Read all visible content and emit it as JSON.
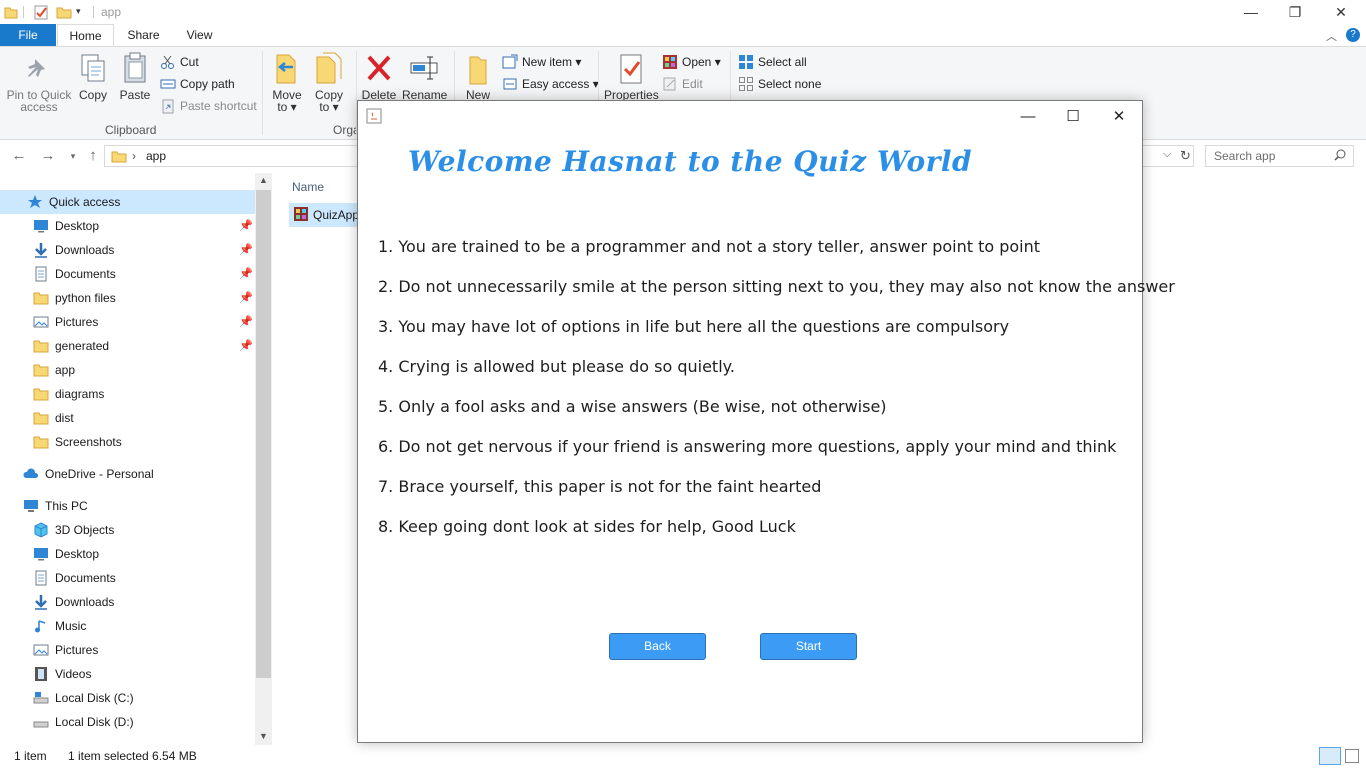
{
  "window": {
    "title": "app"
  },
  "tabs": [
    {
      "label": "File"
    },
    {
      "label": "Home"
    },
    {
      "label": "Share"
    },
    {
      "label": "View"
    }
  ],
  "ribbon": {
    "pin_label_1": "Pin to Quick",
    "pin_label_2": "access",
    "copy": "Copy",
    "paste": "Paste",
    "cut": "Cut",
    "copy_path": "Copy path",
    "paste_shortcut": "Paste shortcut",
    "clipboard_group": "Clipboard",
    "move_to_1": "Move",
    "move_to_2": "to ▾",
    "copy_to_1": "Copy",
    "copy_to_2": "to ▾",
    "organise_group": "Orga",
    "delete": "Delete",
    "rename": "Rename",
    "new_folder": "New",
    "new_item": "New item ▾",
    "easy_access": "Easy access ▾",
    "properties": "Properties",
    "open": "Open ▾",
    "edit": "Edit",
    "select_all": "Select all",
    "select_none": "Select none"
  },
  "address": {
    "path": "app",
    "search_placeholder": "Search app"
  },
  "nav": {
    "quick_access": "Quick access",
    "pinned": [
      {
        "label": "Desktop",
        "pinned": true
      },
      {
        "label": "Downloads",
        "pinned": true
      },
      {
        "label": "Documents",
        "pinned": true
      },
      {
        "label": "python files",
        "pinned": true
      },
      {
        "label": "Pictures",
        "pinned": true
      },
      {
        "label": "generated",
        "pinned": true
      },
      {
        "label": "app",
        "pinned": false
      },
      {
        "label": "diagrams",
        "pinned": false
      },
      {
        "label": "dist",
        "pinned": false
      },
      {
        "label": "Screenshots",
        "pinned": false
      }
    ],
    "onedrive": "OneDrive - Personal",
    "this_pc": "This PC",
    "pc_items": [
      {
        "label": "3D Objects"
      },
      {
        "label": "Desktop"
      },
      {
        "label": "Documents"
      },
      {
        "label": "Downloads"
      },
      {
        "label": "Music"
      },
      {
        "label": "Pictures"
      },
      {
        "label": "Videos"
      },
      {
        "label": "Local Disk (C:)"
      },
      {
        "label": "Local Disk (D:)"
      }
    ]
  },
  "files": {
    "column_name": "Name",
    "selected_file": "QuizApp"
  },
  "status": {
    "count": "1 item",
    "selection": "1 item selected  6.54 MB"
  },
  "dialog": {
    "heading": "Welcome Hasnat to the Quiz World",
    "rules": [
      "1. You are trained to be a programmer and not a story teller, answer point to point",
      "2. Do not unnecessarily smile at the person sitting next to you, they may also not know the answer",
      "3. You may have lot of options in life but here all the questions are compulsory",
      "4. Crying is allowed but please do so quietly.",
      "5. Only a fool asks and a wise answers (Be wise, not otherwise)",
      "6. Do not get nervous if your friend is answering more questions, apply your mind and think",
      "7. Brace yourself, this paper is not for the faint hearted",
      "8. Keep going dont look at sides for help, Good Luck"
    ],
    "back_label": "Back",
    "start_label": "Start"
  },
  "colors": {
    "accent": "#1979ca",
    "heading": "#2b8fe8",
    "button": "#3c9cf5",
    "selection": "#cce8ff"
  }
}
